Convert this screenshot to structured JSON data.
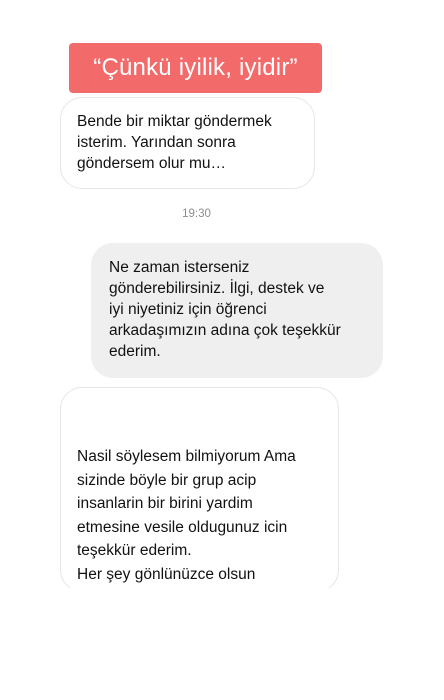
{
  "banner": {
    "text": "“Çünkü iyilik, iyidir”"
  },
  "conversation": {
    "messages": [
      {
        "sender": "received",
        "text": "Bende bir miktar göndermek\nisterim. Yarından sonra\ngöndersem olur mu…"
      },
      {
        "sender": "sent",
        "text": "Ne zaman isterseniz\ngönderebilirsiniz. İlgi, destek ve\niyi niyetiniz için öğrenci\narkadaşımızın adına çok teşekkür\nederim."
      },
      {
        "sender": "received",
        "text": "Nasil söylesem bilmiyorum Ama\nsizinde böyle bir grup acip\ninsanlarin bir birini yardim\netmesine vesile oldugunuz icin\nteşekkür ederim.\nHer şey gönlünüzce olsun"
      }
    ],
    "timestamp": "19:30"
  },
  "colors": {
    "banner_bg": "#f26a6a",
    "sent_bubble_bg": "#efefef",
    "received_bubble_border": "#e6e6e6",
    "timestamp_text": "#8e8e8e"
  }
}
